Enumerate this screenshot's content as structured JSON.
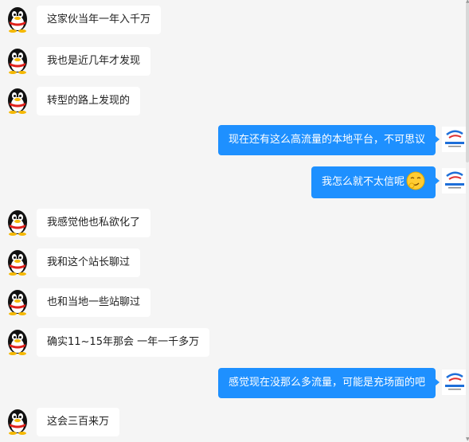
{
  "messages": [
    {
      "side": "in",
      "text": "这家伙当年一年入千万"
    },
    {
      "side": "in",
      "text": "我也是近几年才发现"
    },
    {
      "side": "in",
      "text": "转型的路上发现的"
    },
    {
      "side": "out",
      "text": "现在还有这么高流量的本地平台，不可思议"
    },
    {
      "side": "out",
      "text": "我怎么就不太信呢",
      "emoji": "smirk-emoji-icon"
    },
    {
      "side": "in",
      "text": "我感觉他也私欲化了"
    },
    {
      "side": "in",
      "text": "我和这个站长聊过"
    },
    {
      "side": "in",
      "text": "也和当地一些站聊过"
    },
    {
      "side": "in",
      "text": "确实11~15年那会 一年一千多万"
    },
    {
      "side": "out",
      "text": "感觉现在没那么多流量，可能是充场面的吧"
    },
    {
      "side": "in",
      "text": "这会三百来万"
    }
  ],
  "colors": {
    "outgoing_bubble": "#1e90ff",
    "incoming_bubble": "#ffffff",
    "background": "#f5f5f5"
  },
  "icons": {
    "incoming_avatar": "penguin-avatar-icon",
    "outgoing_avatar": "company-logo-avatar-icon"
  }
}
